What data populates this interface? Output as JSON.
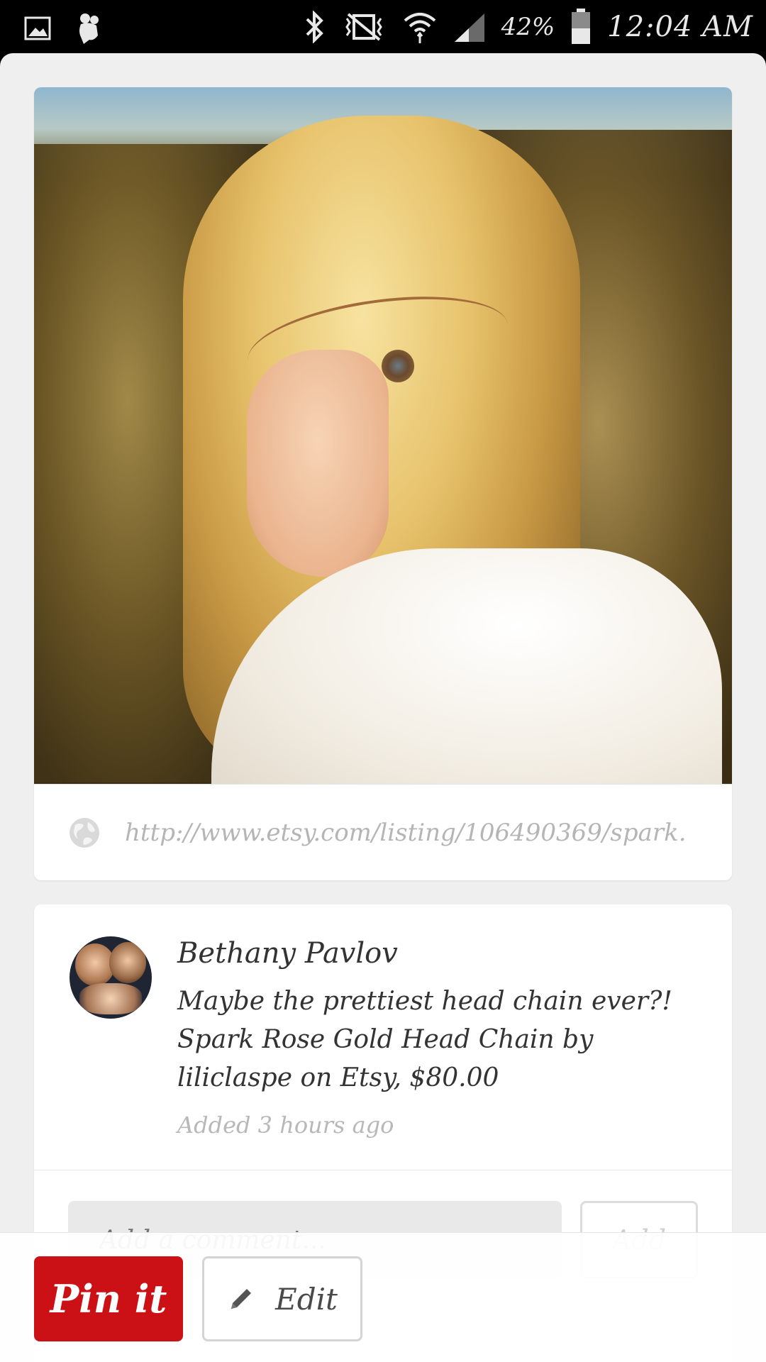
{
  "status_bar": {
    "battery_percent": "42%",
    "time": "12:04 AM",
    "icons": [
      "gallery-icon",
      "notification-character-icon",
      "bluetooth-icon",
      "vibrate-mute-icon",
      "wifi-icon",
      "signal-icon",
      "battery-icon"
    ]
  },
  "pin": {
    "image_alt": "Woman with long blonde hair wearing a head chain",
    "source_url": "http://www.etsy.com/listing/106490369/spark...",
    "source_icon": "globe-icon"
  },
  "details": {
    "user_name": "Bethany Pavlov",
    "description": "Maybe the prettiest head chain ever?! Spark Rose Gold Head Chain by liliclaspe on Etsy, $80.00",
    "added": "Added 3 hours ago"
  },
  "comment": {
    "placeholder": "Add a comment...",
    "add_label": "Add"
  },
  "actions": {
    "pinit_label": "Pin it",
    "edit_label": "Edit",
    "edit_icon": "pencil-icon"
  },
  "colors": {
    "pinterest_red": "#cb1016",
    "background": "#efefef",
    "muted_text": "#b5b5b5"
  }
}
